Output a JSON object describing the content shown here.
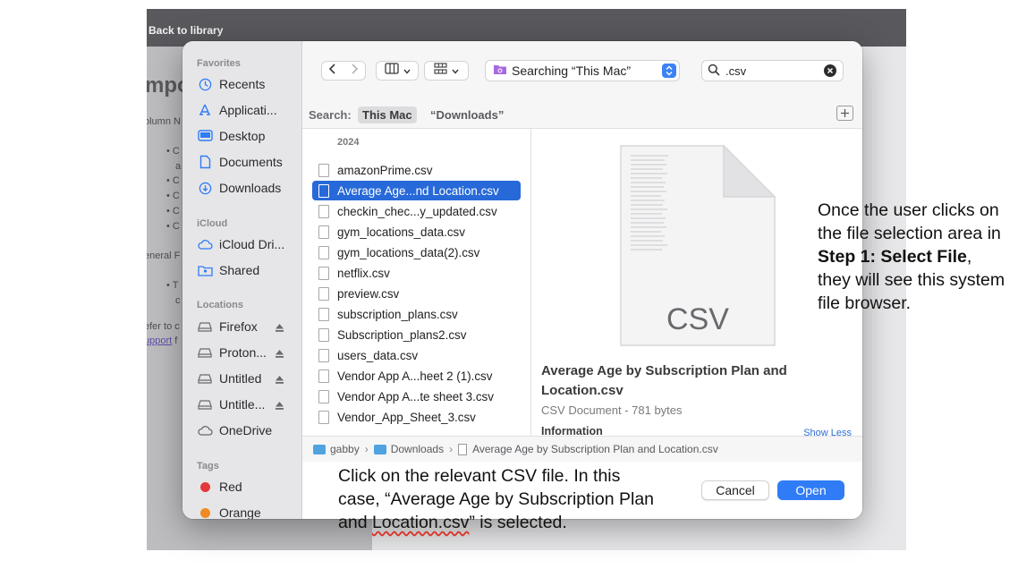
{
  "background_app": {
    "back_link": "Back to library",
    "heading_fragment": "mpo",
    "column_fragment": "olumn N",
    "bullet_fragments": [
      "C",
      "a",
      "C",
      "C",
      "C",
      "C"
    ],
    "general_fragment": "eneral F",
    "bullet2_fragments": [
      "T",
      "c"
    ],
    "refer_fragment": "efer to c",
    "support_link": "upport",
    "support_after": "f"
  },
  "sidebar": {
    "favorites_title": "Favorites",
    "favorites": [
      {
        "label": "Recents",
        "icon": "clock-icon"
      },
      {
        "label": "Applicati...",
        "icon": "applications-icon"
      },
      {
        "label": "Desktop",
        "icon": "desktop-icon"
      },
      {
        "label": "Documents",
        "icon": "document-icon"
      },
      {
        "label": "Downloads",
        "icon": "download-icon"
      }
    ],
    "icloud_title": "iCloud",
    "icloud": [
      {
        "label": "iCloud Dri...",
        "icon": "cloud-icon"
      },
      {
        "label": "Shared",
        "icon": "shared-folder-icon"
      }
    ],
    "locations_title": "Locations",
    "locations": [
      {
        "label": "Firefox",
        "icon": "disk-icon"
      },
      {
        "label": "Proton...",
        "icon": "disk-icon"
      },
      {
        "label": "Untitled",
        "icon": "disk-icon"
      },
      {
        "label": "Untitle...",
        "icon": "disk-icon"
      },
      {
        "label": "OneDrive",
        "icon": "cloud-icon"
      }
    ],
    "tags_title": "Tags",
    "tags": [
      {
        "label": "Red",
        "color": "#e5383b"
      },
      {
        "label": "Orange",
        "color": "#f08a24"
      }
    ]
  },
  "toolbar": {
    "location": "Searching “This Mac”",
    "search_value": ".csv"
  },
  "scope": {
    "label": "Search:",
    "this_mac": "This Mac",
    "downloads": "“Downloads”"
  },
  "files": {
    "group": "2024",
    "items": [
      "amazonPrime.csv",
      "Average Age...nd Location.csv",
      "checkin_chec...y_updated.csv",
      "gym_locations_data.csv",
      "gym_locations_data(2).csv",
      "netflix.csv",
      "preview.csv",
      "subscription_plans.csv",
      "Subscription_plans2.csv",
      "users_data.csv",
      "Vendor App A...heet 2 (1).csv",
      "Vendor App A...te sheet 3.csv",
      "Vendor_App_Sheet_3.csv"
    ],
    "selected_index": 1
  },
  "preview": {
    "icon_label": "CSV",
    "name": "Average Age by Subscription Plan and Location.csv",
    "kind": "CSV Document - 781 bytes",
    "info_title": "Information",
    "show_less": "Show Less"
  },
  "pathbar": {
    "segments": [
      "gabby",
      "Downloads",
      "Average Age by Subscription Plan and Location.csv"
    ]
  },
  "buttons": {
    "cancel": "Cancel",
    "open": "Open"
  },
  "annotations": {
    "bottom_line1": "Click on the relevant CSV file. In this",
    "bottom_line2": "case, “Average Age by Subscription Plan",
    "bottom_line3_pre": "and ",
    "bottom_line3_squig": "Location.csv",
    "bottom_line3_post": "” is selected.",
    "right_pre": "Once the user clicks on the file selection area in ",
    "right_bold": "Step 1: Select File",
    "right_post": ", they will see this system file browser."
  },
  "colors": {
    "accent": "#2f7cf6",
    "selection": "#2769d8",
    "sidebar_bg": "#e6e6e8"
  }
}
